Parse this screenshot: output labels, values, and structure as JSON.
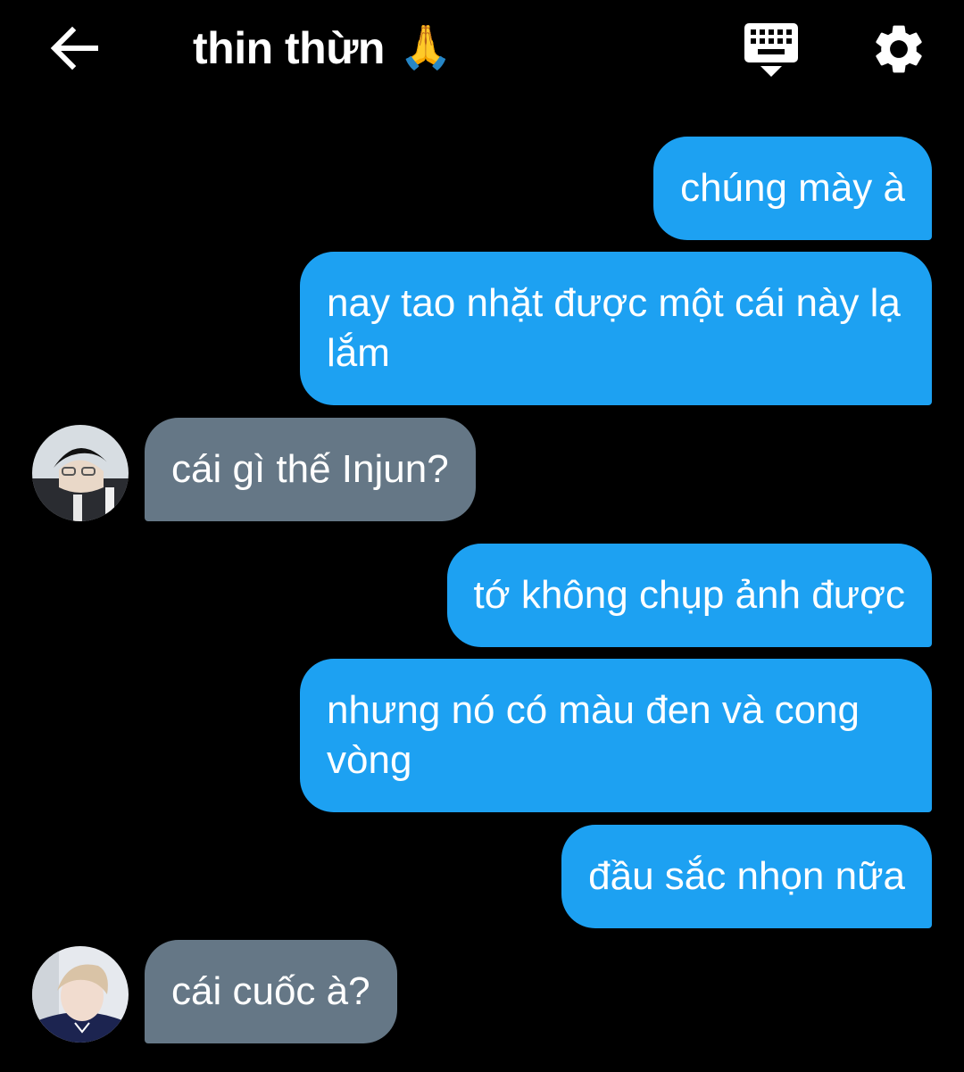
{
  "header": {
    "back_icon": "arrow-left-icon",
    "title": "thin thừn",
    "title_emoji": "🙏",
    "keyboard_icon": "keyboard-icon",
    "settings_icon": "gear-icon"
  },
  "colors": {
    "background": "#000000",
    "sent_bubble": "#1da1f2",
    "received_bubble": "#657786",
    "text": "#ffffff"
  },
  "messages": [
    {
      "direction": "sent",
      "text": "chúng mày à"
    },
    {
      "direction": "sent",
      "text": "nay tao nhặt được một cái này lạ lắm"
    },
    {
      "direction": "received",
      "text": "cái gì thế Injun?",
      "avatar": "avatar-dark-hair"
    },
    {
      "direction": "sent",
      "text": "tớ không chụp ảnh được"
    },
    {
      "direction": "sent",
      "text": "nhưng nó có màu đen và cong vòng"
    },
    {
      "direction": "sent",
      "text": "đầu sắc nhọn nữa"
    },
    {
      "direction": "received",
      "text": "cái cuốc à?",
      "avatar": "avatar-light-hair"
    }
  ]
}
